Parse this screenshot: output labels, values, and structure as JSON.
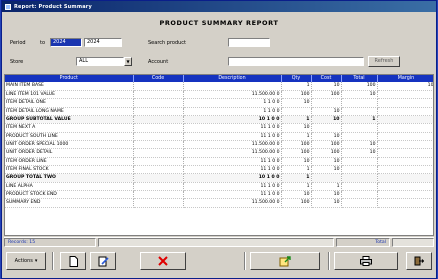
{
  "window": {
    "title": "Report: Product Summary"
  },
  "header": {
    "title": "PRODUCT SUMMARY REPORT"
  },
  "filters": {
    "period_label": "Period",
    "period_from": "2024",
    "period_to_label": "to",
    "period_to": "2024",
    "search_label": "Search product",
    "search_value": "",
    "store_label": "Store",
    "store_value": "ALL",
    "account_label": "Account",
    "account_value": "",
    "refresh_label": "Refresh"
  },
  "grid": {
    "columns": [
      "Product",
      "Code",
      "Description",
      "Qty",
      "Cost",
      "Total",
      "Margin"
    ],
    "rows": [
      {
        "cells": [
          "MAIN ITEM BASE",
          "",
          "",
          "1",
          "10",
          "100",
          "10"
        ],
        "group": false
      },
      {
        "cells": [
          "LINE ITEM 101 VALUE",
          "",
          "11.500.00 0",
          "100",
          "100",
          "10",
          ""
        ],
        "group": false
      },
      {
        "cells": [
          "ITEM DETAIL ONE",
          "",
          "1 1 0 0",
          "10",
          "",
          "",
          ""
        ],
        "group": false
      },
      {
        "cells": [
          "ITEM DETAIL LONG NAME",
          "",
          "1 1 0 0",
          "",
          "10",
          "",
          ""
        ],
        "group": false
      },
      {
        "cells": [
          "GROUP SUBTOTAL VALUE",
          "",
          "10 1 0 0",
          "1",
          "10",
          "1",
          ""
        ],
        "group": true
      },
      {
        "cells": [
          "ITEM NEXT A",
          "",
          "11 1 0 0",
          "10",
          "",
          "",
          ""
        ],
        "group": false
      },
      {
        "cells": [
          "PRODUCT SOUTH LINE",
          "",
          "11 1 0 0",
          "1",
          "10",
          "",
          ""
        ],
        "group": false
      },
      {
        "cells": [
          "UNIT ORDER SPECIAL 1000",
          "",
          "11.500.00 0",
          "100",
          "100",
          "10",
          ""
        ],
        "group": false
      },
      {
        "cells": [
          "UNIT ORDER DETAIL",
          "",
          "11.500.00 0",
          "100",
          "100",
          "10",
          ""
        ],
        "group": false
      },
      {
        "cells": [
          "ITEM ORDER LINE",
          "",
          "11 1 0 0",
          "10",
          "10",
          "",
          ""
        ],
        "group": false
      },
      {
        "cells": [
          "ITEM FINAL STOCK",
          "",
          "11 1 0 0",
          "1",
          "10",
          "",
          ""
        ],
        "group": false
      },
      {
        "cells": [
          "GROUP TOTAL TWO",
          "",
          "10 1 0 0",
          "1",
          "",
          "",
          ""
        ],
        "group": true
      },
      {
        "cells": [
          "LINE ALPHA",
          "",
          "11 1 0 0",
          "1",
          "1",
          "",
          ""
        ],
        "group": false
      },
      {
        "cells": [
          "PRODUCT STOCK END",
          "",
          "11 1 0 0",
          "10",
          "10",
          "",
          ""
        ],
        "group": false
      },
      {
        "cells": [
          "SUMMARY END",
          "",
          "11.500.00 0",
          "100",
          "10",
          "",
          ""
        ],
        "group": false
      }
    ]
  },
  "status": {
    "left": "Records: 15",
    "middle": "",
    "right": "Total",
    "right_value": ""
  },
  "toolbar": {
    "menu_label": "Actions",
    "icons": [
      "new-icon",
      "edit-icon",
      "delete-icon",
      "export-icon",
      "print-icon",
      "exit-icon"
    ]
  }
}
